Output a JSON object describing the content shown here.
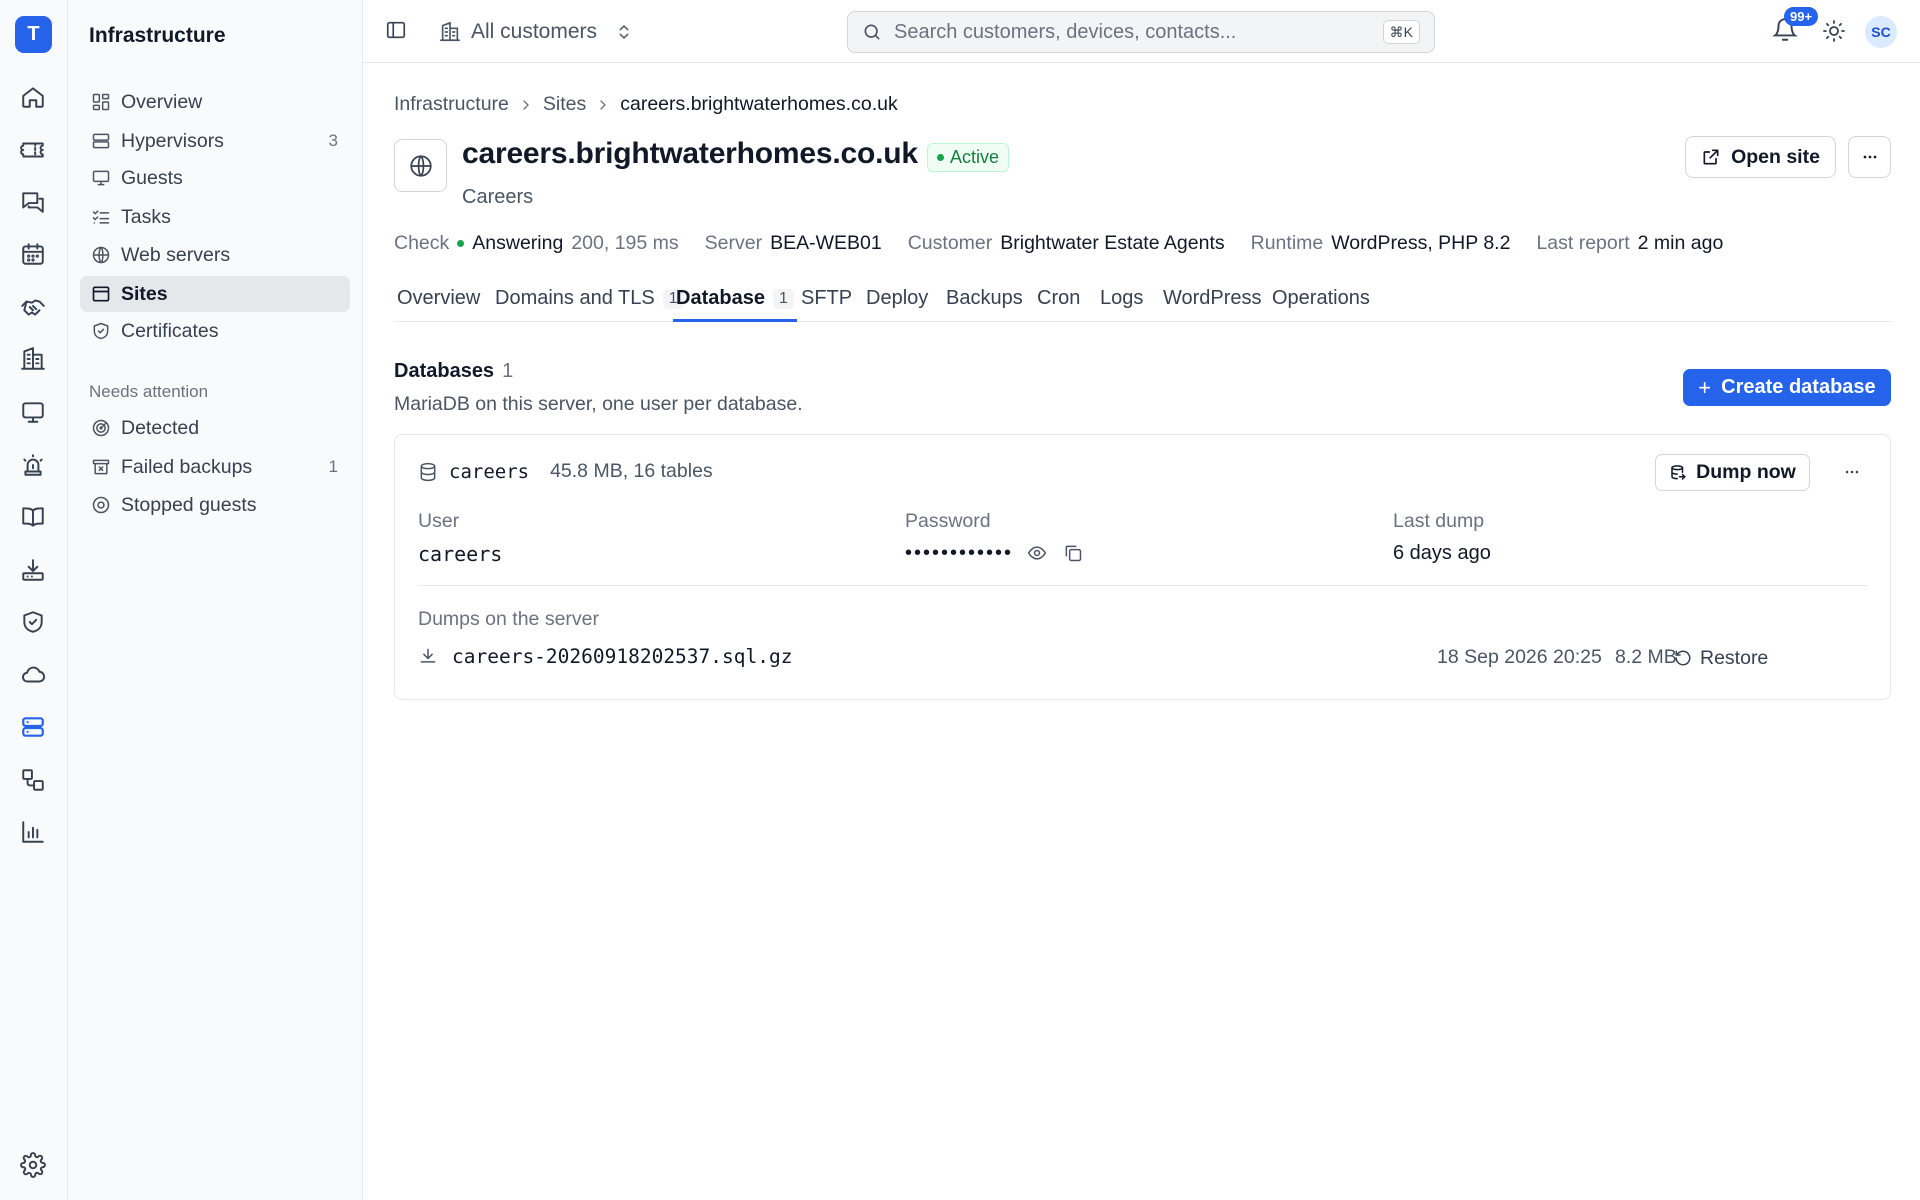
{
  "app": {
    "logo_letter": "T"
  },
  "rail": {
    "items": [
      {
        "icon": "home-icon"
      },
      {
        "icon": "ticket-icon"
      },
      {
        "icon": "messages-icon"
      },
      {
        "icon": "calendar-icon"
      },
      {
        "icon": "handshake-icon"
      },
      {
        "icon": "building-icon"
      },
      {
        "icon": "monitor-icon"
      },
      {
        "icon": "siren-icon"
      },
      {
        "icon": "book-icon"
      },
      {
        "icon": "download-tray-icon"
      },
      {
        "icon": "shield-check-icon"
      },
      {
        "icon": "cloud-icon"
      },
      {
        "icon": "server-icon",
        "active": true
      },
      {
        "icon": "workflow-icon"
      },
      {
        "icon": "bar-chart-icon"
      }
    ],
    "settings_icon": "gear-icon"
  },
  "sidebar": {
    "title": "Infrastructure",
    "items": [
      {
        "label": "Overview",
        "icon": "dashboard-icon"
      },
      {
        "label": "Hypervisors",
        "icon": "server-stack-icon",
        "count": "3"
      },
      {
        "label": "Guests",
        "icon": "monitor-icon"
      },
      {
        "label": "Tasks",
        "icon": "list-checks-icon"
      },
      {
        "label": "Web servers",
        "icon": "globe-icon"
      },
      {
        "label": "Sites",
        "icon": "browser-window-icon",
        "active": true
      },
      {
        "label": "Certificates",
        "icon": "shield-check-icon"
      }
    ],
    "attention_title": "Needs attention",
    "attention_items": [
      {
        "label": "Detected",
        "icon": "radar-icon"
      },
      {
        "label": "Failed backups",
        "icon": "archive-x-icon",
        "count": "1"
      },
      {
        "label": "Stopped guests",
        "icon": "stop-circle-icon"
      }
    ]
  },
  "topbar": {
    "customer_selector": "All customers",
    "search_placeholder": "Search customers, devices, contacts...",
    "search_shortcut": "⌘K",
    "notifications_badge": "99+",
    "avatar_initials": "SC"
  },
  "breadcrumb": [
    "Infrastructure",
    "Sites",
    "careers.brightwaterhomes.co.uk"
  ],
  "site": {
    "title": "careers.brightwaterhomes.co.uk",
    "status": "Active",
    "subtitle": "Careers",
    "open_button": "Open site",
    "meta": {
      "check_label": "Check",
      "check_value": "Answering",
      "check_detail": "200, 195 ms",
      "server_label": "Server",
      "server_value": "BEA-WEB01",
      "customer_label": "Customer",
      "customer_value": "Brightwater Estate Agents",
      "runtime_label": "Runtime",
      "runtime_value": "WordPress, PHP 8.2",
      "last_report_label": "Last report",
      "last_report_value": "2 min ago"
    }
  },
  "tabs": [
    {
      "label": "Overview"
    },
    {
      "label": "Domains and TLS",
      "count": "1"
    },
    {
      "label": "Database",
      "count": "1",
      "active": true
    },
    {
      "label": "SFTP"
    },
    {
      "label": "Deploy"
    },
    {
      "label": "Backups"
    },
    {
      "label": "Cron"
    },
    {
      "label": "Logs"
    },
    {
      "label": "WordPress"
    },
    {
      "label": "Operations"
    }
  ],
  "databases": {
    "title": "Databases",
    "count": "1",
    "description": "MariaDB on this server, one user per database.",
    "create_button": "Create database",
    "items": [
      {
        "name": "careers",
        "size": "45.8 MB, 16 tables",
        "dump_button": "Dump now",
        "user_label": "User",
        "user_value": "careers",
        "password_label": "Password",
        "password_mask": "••••••••••••",
        "last_dump_label": "Last dump",
        "last_dump_value": "6 days ago",
        "dumps_label": "Dumps on the server",
        "dumps": [
          {
            "file": "careers-20260918202537.sql.gz",
            "date": "18 Sep 2026 20:25",
            "size": "8.2 MB",
            "restore": "Restore"
          }
        ]
      }
    ]
  },
  "colors": {
    "accent": "#2563eb",
    "success": "#16a34a",
    "muted": "#6b7280"
  }
}
